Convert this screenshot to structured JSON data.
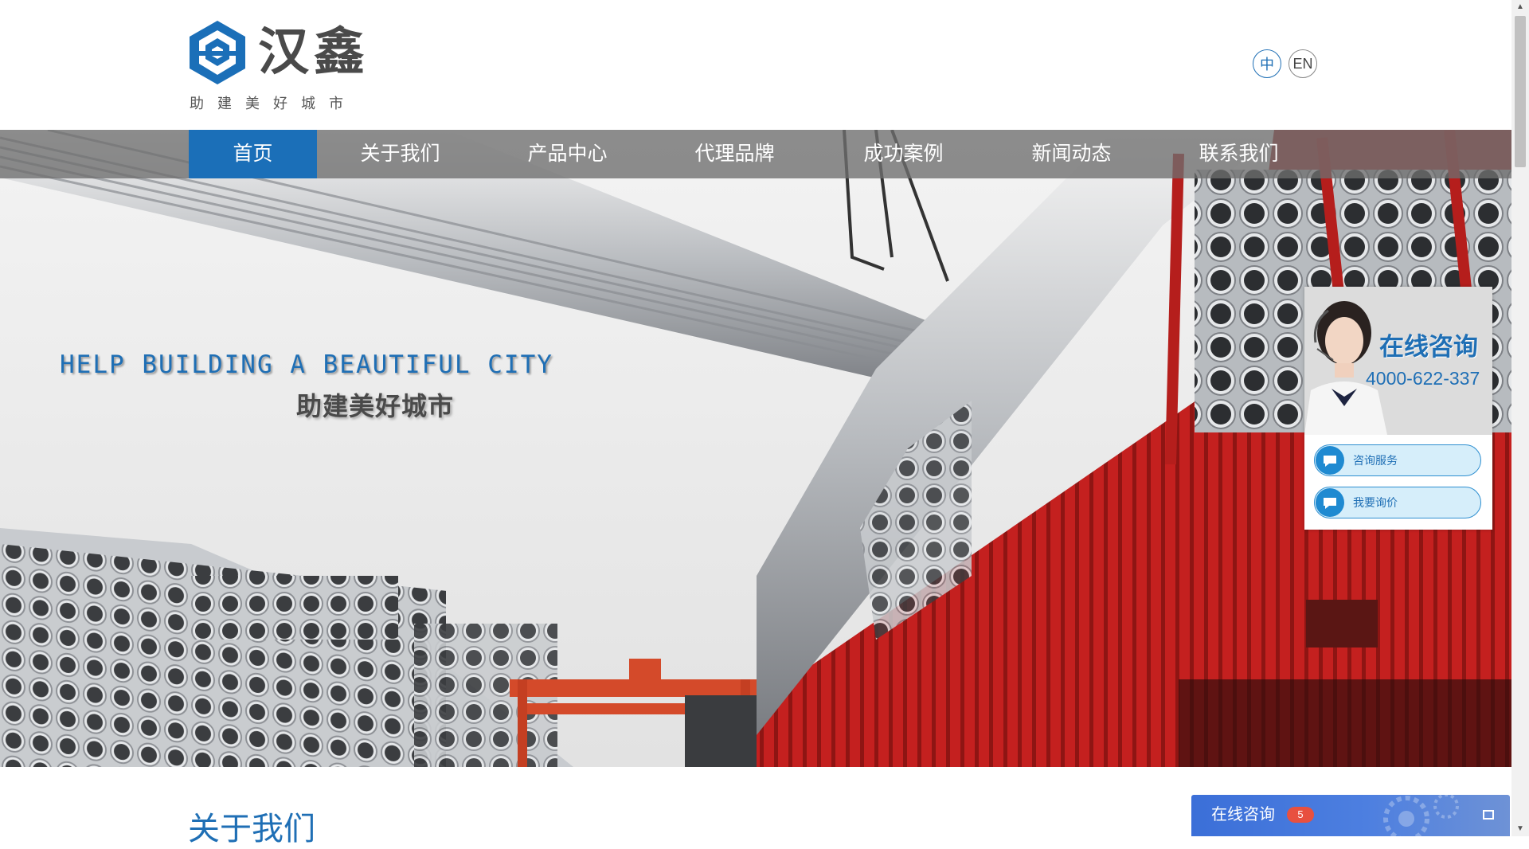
{
  "brand": {
    "name": "汉鑫",
    "slogan": "助建美好城市"
  },
  "lang": {
    "zh": "中",
    "en": "EN"
  },
  "nav": {
    "items": [
      {
        "label": "首页",
        "active": true
      },
      {
        "label": "关于我们",
        "active": false
      },
      {
        "label": "产品中心",
        "active": false
      },
      {
        "label": "代理品牌",
        "active": false
      },
      {
        "label": "成功案例",
        "active": false
      },
      {
        "label": "新闻动态",
        "active": false
      },
      {
        "label": "联系我们",
        "active": false
      }
    ]
  },
  "hero": {
    "en_tagline": "HELP BUILDING A BEAUTIFUL CITY",
    "cn_tagline": "助建美好城市"
  },
  "consult": {
    "title": "在线咨询",
    "phone": "4000-622-337",
    "buttons": [
      {
        "label": "咨询服务"
      },
      {
        "label": "我要询价"
      }
    ]
  },
  "section": {
    "about_title": "关于我们"
  },
  "chat": {
    "label": "在线咨询",
    "badge": "5"
  },
  "colors": {
    "brand_blue": "#1b6fb8",
    "nav_bg": "#6e6e6e",
    "truck_red": "#c0201e",
    "chat_blue": "#3b6fd8",
    "badge_red": "#e8503f"
  }
}
